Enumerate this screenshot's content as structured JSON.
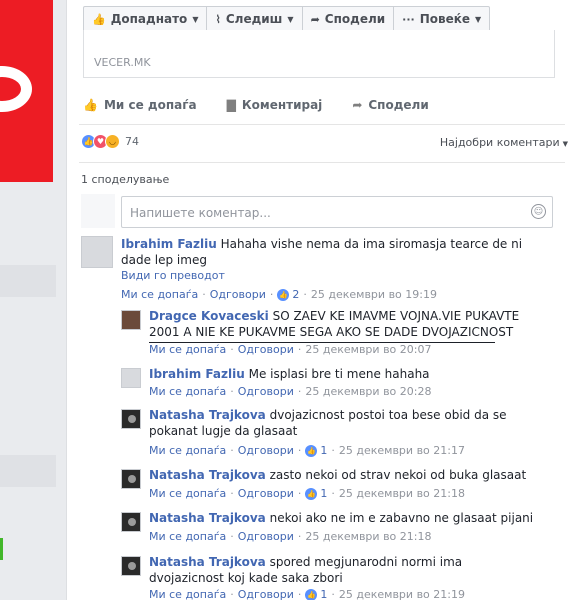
{
  "pagebar": {
    "liked": "Допаднато",
    "follow": "Следиш",
    "share": "Сподели",
    "more": "Повеќе"
  },
  "link": {
    "source": "VECER.MK"
  },
  "actions": {
    "like": "Ми се допаѓа",
    "comment": "Коментирај",
    "share": "Сподели"
  },
  "reactions": {
    "count": "74",
    "sort_label": "Најдобри коментари"
  },
  "shares_label": "1 споделување",
  "composer": {
    "placeholder": "Напишете коментар..."
  },
  "meta_labels": {
    "like": "Ми се допаѓа",
    "reply": "Одговори",
    "translate": "Види го преводот"
  },
  "comments": [
    {
      "name": "Ibrahim Fazliu",
      "text": "Hahaha vishe nema da ima siromasja tearce de ni dade lep imeg",
      "likes": "2",
      "time": "25 декември во 19:19"
    }
  ],
  "replies": [
    {
      "name": "Dragce Kovaceski",
      "text": "SO ZAEV KE IMAVME VOJNA.VIE PUKAVTE 2001 A NIE KE PUKAVME SEGA AKO SE DADE DVOJAZICNOST",
      "likes": "",
      "time": "25 декември во 20:07"
    },
    {
      "name": "Ibrahim Fazliu",
      "text": "Me isplasi bre ti mene hahaha",
      "likes": "",
      "time": "25 декември во 20:28"
    },
    {
      "name": "Natasha Trajkova",
      "text": "dvojazicnost postoi toa bese obid da se pokanat lugje da glasaat",
      "likes": "1",
      "time": "25 декември во 21:17"
    },
    {
      "name": "Natasha Trajkova",
      "text": "zasto nekoi od strav nekoi od buka glasaat",
      "likes": "1",
      "time": "25 декември во 21:18"
    },
    {
      "name": "Natasha Trajkova",
      "text": "nekoi ako ne im e zabavno ne glasaat pijani",
      "likes": "",
      "time": "25 декември во 21:18"
    },
    {
      "name": "Natasha Trajkova",
      "text": "spored megjunarodni normi ima dvojazicnost koj kade saka zbori",
      "likes": "1",
      "time": "25 декември во 21:19"
    }
  ]
}
